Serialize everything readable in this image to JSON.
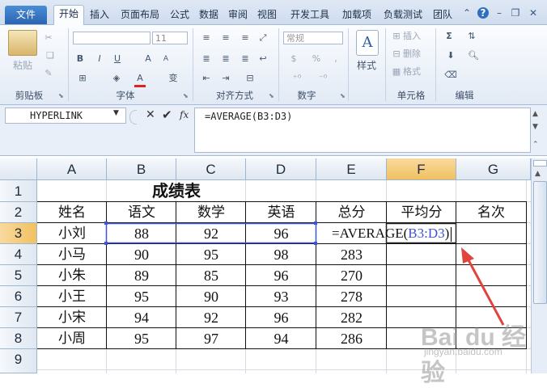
{
  "ribbon_tabs": [
    "文件",
    "开始",
    "插入",
    "页面布局",
    "公式",
    "数据",
    "审阅",
    "视图",
    "开发工具",
    "加载项",
    "负载测试",
    "团队"
  ],
  "ribbon": {
    "clipboard": {
      "paste": "粘贴",
      "label": "剪贴板"
    },
    "font": {
      "size": "11",
      "bold": "B",
      "italic": "I",
      "underline": "U",
      "grow": "A",
      "shrink": "A",
      "color": "A",
      "phonetic": "变",
      "label": "字体"
    },
    "alignment": {
      "label": "对齐方式"
    },
    "number": {
      "format": "常规",
      "percent": "%",
      "comma": ",",
      "label": "数字"
    },
    "styles": {
      "style_btn": "样式"
    },
    "cells": {
      "insert": "插入",
      "delete": "删除",
      "format": "格式",
      "label": "单元格"
    },
    "editing": {
      "sum": "Σ",
      "label": "编辑"
    }
  },
  "formula_bar": {
    "name_box": "HYPERLINK",
    "fx_label": "fx",
    "formula": "=AVERAGE(B3:D3)"
  },
  "grid": {
    "columns": [
      "A",
      "B",
      "C",
      "D",
      "E",
      "F",
      "G"
    ],
    "rows": [
      "1",
      "2",
      "3",
      "4",
      "5",
      "6",
      "7",
      "8",
      "9"
    ],
    "title": "成绩表",
    "headers": [
      "姓名",
      "语文",
      "数学",
      "英语",
      "总分",
      "平均分",
      "名次"
    ],
    "data": [
      [
        "小刘",
        "88",
        "92",
        "96",
        ""
      ],
      [
        "小马",
        "90",
        "95",
        "98",
        "283"
      ],
      [
        "小朱",
        "89",
        "85",
        "96",
        "270"
      ],
      [
        "小王",
        "95",
        "90",
        "93",
        "278"
      ],
      [
        "小宋",
        "94",
        "92",
        "96",
        "282"
      ],
      [
        "小周",
        "95",
        "97",
        "94",
        "286"
      ]
    ],
    "editing_formula_prefix": "=AVERAGE(",
    "editing_formula_ref": "B3:D3",
    "editing_formula_suffix": ")"
  },
  "colors": {
    "ref_highlight": "#3a55d6",
    "selected_header": "#f4c96a",
    "arrow": "#e0443c"
  },
  "watermark": {
    "main": "Bai du 经验",
    "sub": "jingyan.baidu.com"
  }
}
